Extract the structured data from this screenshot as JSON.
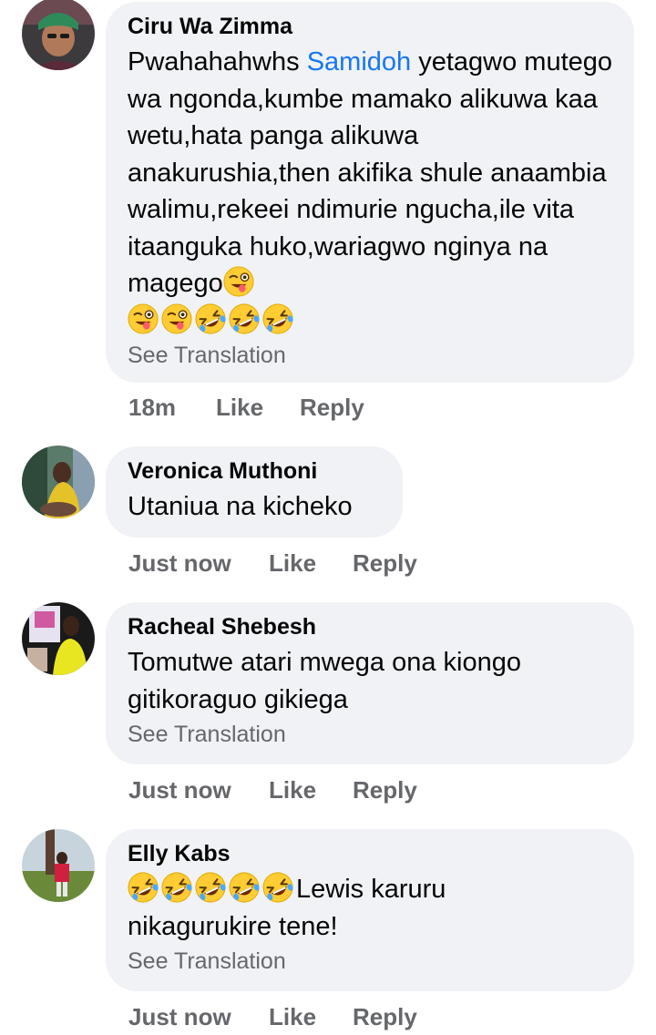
{
  "comments": [
    {
      "author": "Ciru Wa Zimma",
      "text_before": "Pwahahahwhs ",
      "mention": "Samidoh",
      "text_after": " yetagwo mutego wa ngonda,kumbe mamako alikuwa kaa wetu,hata panga alikuwa anakurushia,then akifika shule anaambia walimu,rekeei ndimurie ngucha,ile vita itaanguka huko,wariagwo nginya na magego",
      "emoji_inline": [
        "winking-tongue-emoji"
      ],
      "emoji_row": [
        "winking-tongue-emoji",
        "winking-tongue-emoji",
        "rofl-emoji",
        "rofl-emoji",
        "rofl-emoji"
      ],
      "see_translation": "See Translation",
      "time": "18m",
      "like": "Like",
      "reply": "Reply"
    },
    {
      "author": "Veronica Muthoni",
      "text": "Utaniua na kicheko",
      "time": "Just now",
      "like": "Like",
      "reply": "Reply"
    },
    {
      "author": "Racheal Shebesh",
      "text": "Tomutwe atari mwega ona kiongo gitikoraguo  gikiega",
      "see_translation": "See Translation",
      "time": "Just now",
      "like": "Like",
      "reply": "Reply"
    },
    {
      "author": "Elly Kabs",
      "emoji_lead": [
        "rofl-emoji",
        "rofl-emoji",
        "rofl-emoji",
        "rofl-emoji",
        "rofl-emoji"
      ],
      "text": "Lewis karuru nikagurukire tene!",
      "see_translation": "See Translation",
      "time": "Just now",
      "like": "Like",
      "reply": "Reply"
    }
  ],
  "colors": {
    "bubble": "#f0f2f5",
    "meta": "#65676b",
    "mention": "#1877f2",
    "emoji": "#ffcc33"
  }
}
